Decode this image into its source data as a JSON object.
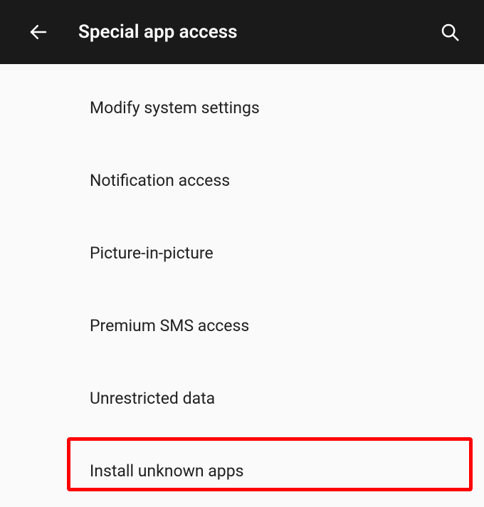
{
  "header": {
    "title": "Special app access"
  },
  "list": {
    "items": [
      {
        "label": "Modify system settings"
      },
      {
        "label": "Notification access"
      },
      {
        "label": "Picture-in-picture"
      },
      {
        "label": "Premium SMS access"
      },
      {
        "label": "Unrestricted data"
      },
      {
        "label": "Install unknown apps"
      }
    ]
  }
}
